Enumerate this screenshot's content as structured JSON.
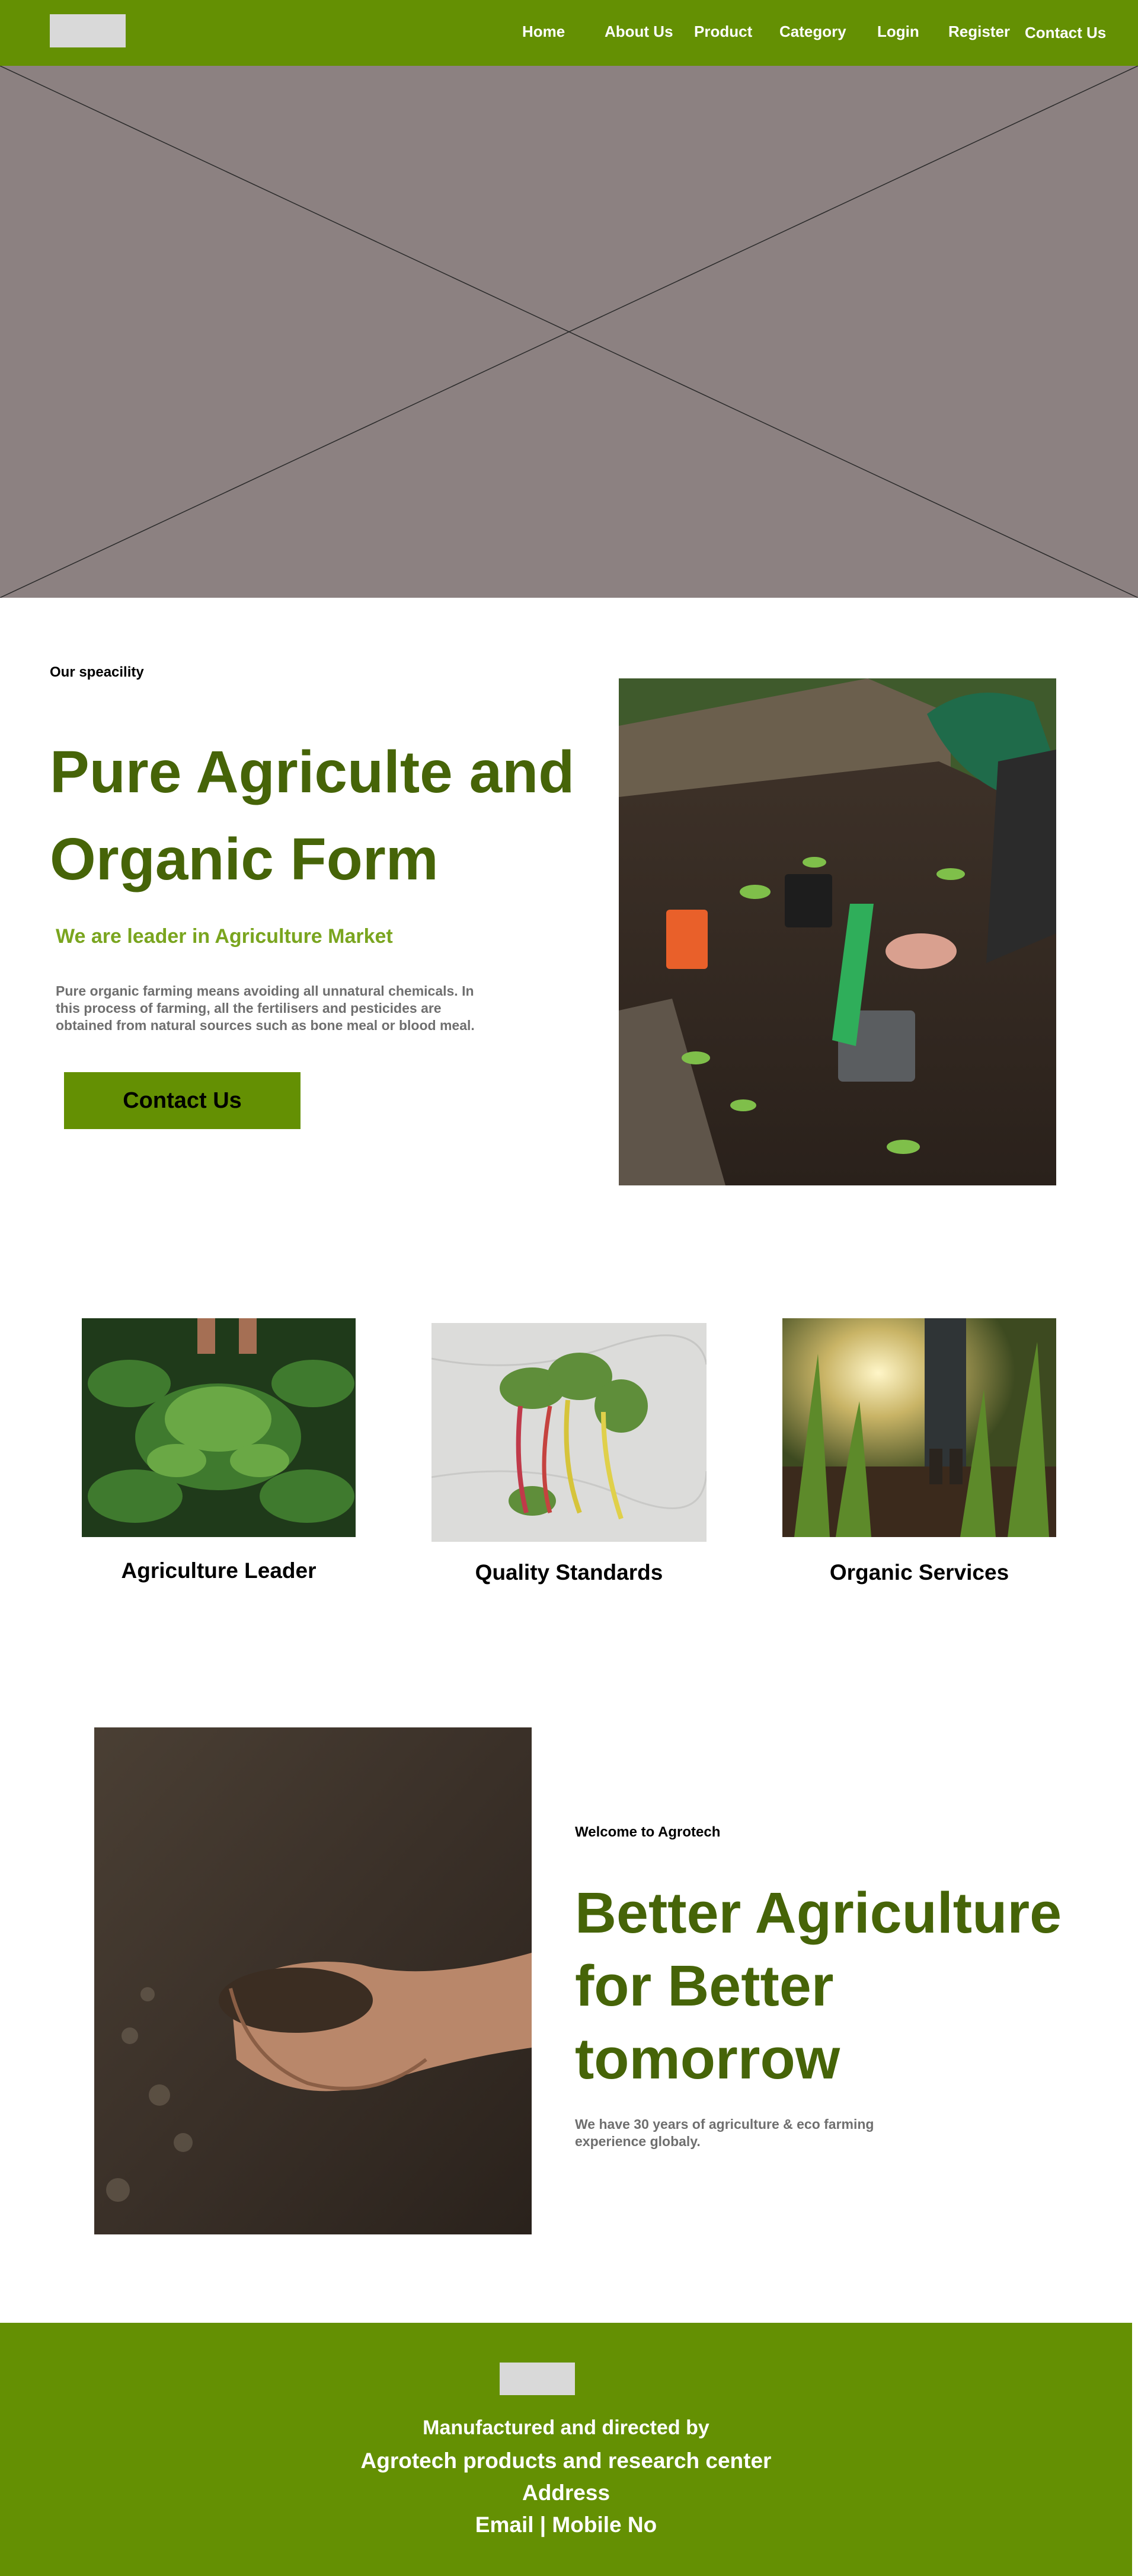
{
  "nav": {
    "items": [
      "Home",
      "About Us",
      "Product",
      "Category",
      "Login",
      "Register",
      "Contact Us"
    ]
  },
  "speciality": {
    "eyebrow": "Our speacility",
    "title_line1": "Pure Agriculte and",
    "title_line2": "Organic Form",
    "subtitle": "We are leader in Agriculture Market",
    "paragraph_line1": "Pure organic farming means avoiding all unnatural chemicals. In",
    "paragraph_line2": "this process of farming, all the fertilisers and pesticides are",
    "paragraph_line3": "obtained from natural sources such as bone meal or blood meal.",
    "cta_label": "Contact Us"
  },
  "features": [
    {
      "title": "Agriculture Leader"
    },
    {
      "title": "Quality Standards"
    },
    {
      "title": "Organic Services"
    }
  ],
  "about": {
    "eyebrow": "Welcome to Agrotech",
    "title_line1": "Better Agriculture",
    "title_line2": "for Better",
    "title_line3": "tomorrow",
    "paragraph_line1": "We have 30 years of agriculture & eco farming",
    "paragraph_line2": "experience globaly."
  },
  "footer": {
    "line1": "Manufactured and directed by",
    "line2": "Agrotech products and research center",
    "line3": "Address",
    "line4": "Email | Mobile No"
  },
  "colors": {
    "brand_green": "#649003",
    "heading_green": "#466408",
    "accent_green": "#7aa51f",
    "placeholder_gray": "#8c8181"
  }
}
